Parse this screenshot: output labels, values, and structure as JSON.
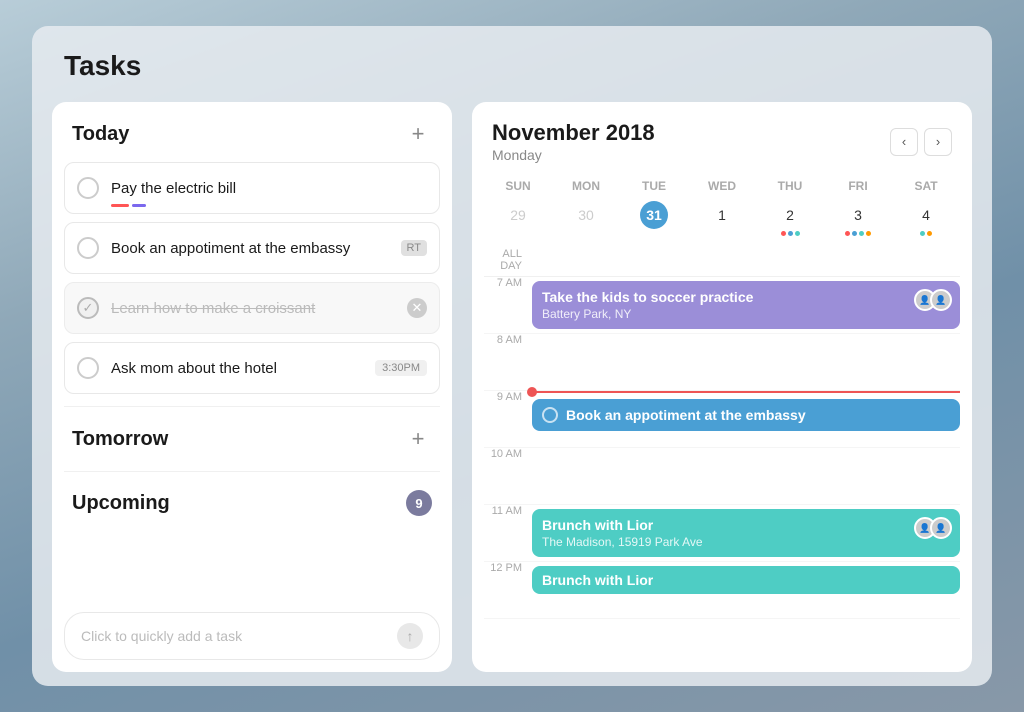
{
  "app": {
    "title": "Tasks"
  },
  "left_panel": {
    "today_label": "Today",
    "tomorrow_label": "Tomorrow",
    "upcoming_label": "Upcoming",
    "upcoming_count": "9",
    "quick_add_placeholder": "Click to quickly add a task",
    "tasks_today": [
      {
        "id": "task1",
        "text": "Pay the electric bill",
        "completed": false,
        "has_underline": true,
        "badge": null,
        "time_badge": null
      },
      {
        "id": "task2",
        "text": "Book an appotiment at the embassy",
        "completed": false,
        "has_underline": false,
        "badge": "RT",
        "time_badge": null
      },
      {
        "id": "task3",
        "text": "Learn how to make a croissant",
        "completed": true,
        "has_underline": false,
        "badge": null,
        "time_badge": null,
        "has_close": true
      },
      {
        "id": "task4",
        "text": "Ask mom about the hotel",
        "completed": false,
        "has_underline": false,
        "badge": null,
        "time_badge": "3:30PM"
      }
    ]
  },
  "right_panel": {
    "month": "November 2018",
    "day_name": "Monday",
    "nav_prev": "‹",
    "nav_next": "›",
    "col_headers": [
      "SUN",
      "MON",
      "TUE",
      "WED",
      "THU",
      "FRI",
      "SAT"
    ],
    "weeks": [
      [
        {
          "num": "29",
          "muted": true,
          "today": false,
          "dots": []
        },
        {
          "num": "30",
          "muted": true,
          "today": false,
          "dots": []
        },
        {
          "num": "31",
          "muted": false,
          "today": true,
          "dots": []
        },
        {
          "num": "1",
          "muted": false,
          "today": false,
          "dots": []
        },
        {
          "num": "2",
          "muted": false,
          "today": false,
          "dots": [
            "red",
            "blue",
            "teal"
          ]
        },
        {
          "num": "3",
          "muted": false,
          "today": false,
          "dots": [
            "red",
            "blue",
            "teal",
            "orange"
          ]
        },
        {
          "num": "4",
          "muted": false,
          "today": false,
          "dots": [
            "teal",
            "orange"
          ]
        }
      ]
    ],
    "all_day_label": "ALL DAY",
    "time_slots": [
      {
        "time": "7 AM",
        "has_event": true,
        "event": {
          "type": "purple",
          "title": "Take the kids to soccer practice",
          "subtitle": "Battery Park, NY",
          "has_avatars": true
        },
        "has_current_time": false
      },
      {
        "time": "8 AM",
        "has_event": false,
        "event": null,
        "has_current_time": false
      },
      {
        "time": "9 AM",
        "has_event": true,
        "event": {
          "type": "blue",
          "title": "Book an appotiment at the embassy",
          "subtitle": null,
          "has_avatars": false,
          "has_checkbox": true
        },
        "has_current_time": true
      },
      {
        "time": "10 AM",
        "has_event": false,
        "event": null,
        "has_current_time": false
      },
      {
        "time": "11 AM",
        "has_event": true,
        "event": {
          "type": "teal",
          "title": "Brunch with Lior",
          "subtitle": "The Madison, 15919 Park Ave",
          "has_avatars": true
        },
        "has_current_time": false
      },
      {
        "time": "12 PM",
        "has_event": true,
        "event": {
          "type": "teal",
          "title": "Brunch with Lior",
          "subtitle": null,
          "has_avatars": false
        },
        "has_current_time": false
      }
    ]
  }
}
